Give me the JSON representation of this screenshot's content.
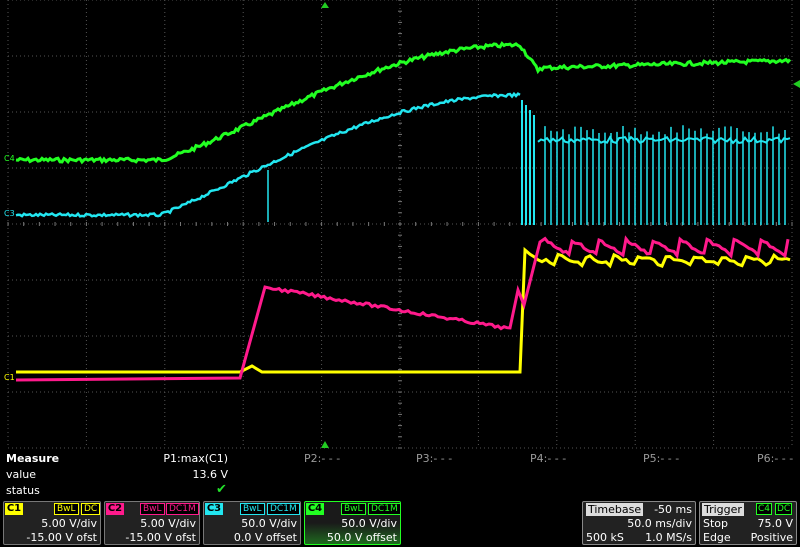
{
  "colors": {
    "c1": "#ffff00",
    "c2": "#ff1a8c",
    "c3": "#22e6f0",
    "c4": "#22ff22",
    "grid": "#555555",
    "marker": "#22cc22"
  },
  "markers": {
    "c4": "C4",
    "c3": "C3",
    "c1": "C1"
  },
  "measure": {
    "title": "Measure",
    "value_label": "value",
    "status_label": "status",
    "p1": {
      "name": "P1:max(C1)",
      "value": "13.6 V",
      "status": "✔"
    },
    "p2": "P2:- - -",
    "p3": "P3:- - -",
    "p4": "P4:- - -",
    "p5": "P5:- - -",
    "p6": "P6:- - -"
  },
  "channels": [
    {
      "id": "C1",
      "bw": "BwL",
      "coupling": "DC",
      "vdiv": "5.00 V/div",
      "offset": "-15.00 V ofst"
    },
    {
      "id": "C2",
      "bw": "BwL",
      "coupling": "DC1M",
      "vdiv": "5.00 V/div",
      "offset": "-15.00 V ofst"
    },
    {
      "id": "C3",
      "bw": "BwL",
      "coupling": "DC1M",
      "vdiv": "50.0 V/div",
      "offset": "0.0 V offset"
    },
    {
      "id": "C4",
      "bw": "BwL",
      "coupling": "DC1M",
      "vdiv": "50.0 V/div",
      "offset": "50.0 V offset"
    }
  ],
  "timebase": {
    "label": "Timebase",
    "delay": "-50 ms",
    "tdiv": "50.0 ms/div",
    "samples": "500 kS",
    "rate": "1.0 MS/s"
  },
  "trigger": {
    "label": "Trigger",
    "source": "C4",
    "coupling": "DC",
    "mode": "Stop",
    "level": "75.0 V",
    "type": "Edge",
    "slope": "Positive"
  }
}
